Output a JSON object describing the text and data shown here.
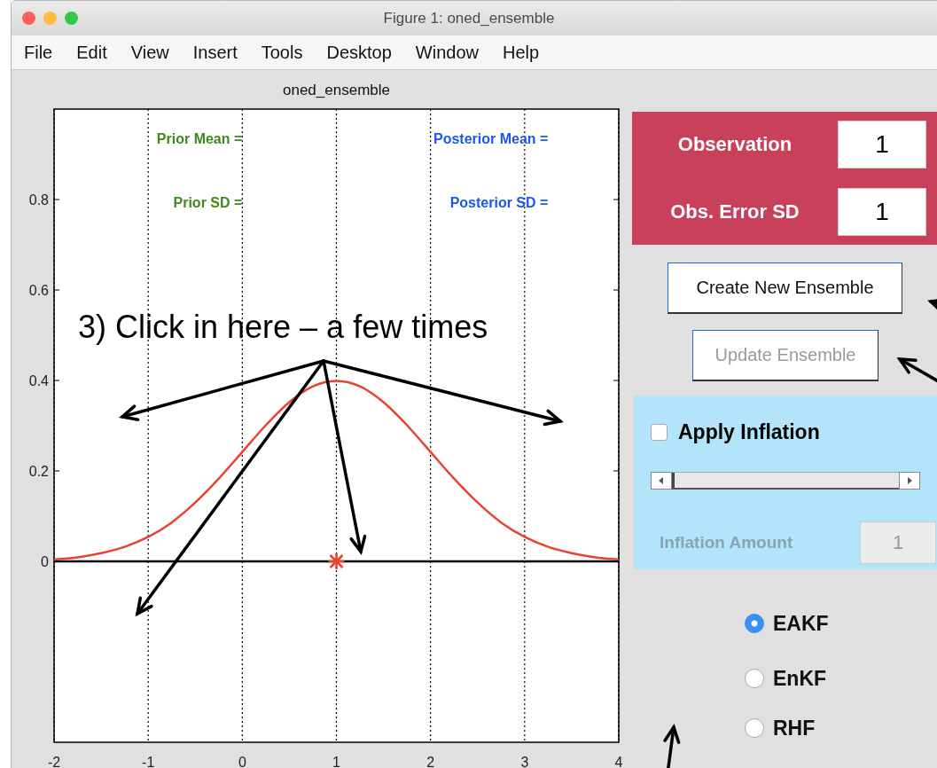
{
  "window": {
    "title": "Figure 1: oned_ensemble"
  },
  "menu": [
    "File",
    "Edit",
    "View",
    "Insert",
    "Tools",
    "Desktop",
    "Window",
    "Help"
  ],
  "plot": {
    "chart_data": {
      "type": "line",
      "title": "oned_ensemble",
      "x": [
        -2,
        -1.75,
        -1.5,
        -1.25,
        -1,
        -0.75,
        -0.5,
        -0.25,
        0,
        0.25,
        0.5,
        0.75,
        1,
        1.25,
        1.5,
        1.75,
        2,
        2.25,
        2.5,
        2.75,
        3,
        3.25,
        3.5,
        3.75,
        4
      ],
      "series": [
        {
          "color": "#e8432e",
          "values": [
            0.004,
            0.009,
            0.018,
            0.032,
            0.054,
            0.086,
            0.13,
            0.183,
            0.242,
            0.301,
            0.352,
            0.387,
            0.399,
            0.387,
            0.352,
            0.301,
            0.242,
            0.183,
            0.13,
            0.086,
            0.054,
            0.032,
            0.018,
            0.009,
            0.004
          ]
        }
      ],
      "xlim": [
        -2,
        4
      ],
      "ylim": [
        -0.4,
        1
      ],
      "xticks": [
        -2,
        -1,
        0,
        1,
        2,
        3,
        4
      ],
      "yticks": [
        0,
        0.2,
        0.4,
        0.6,
        0.8
      ],
      "grid": true
    },
    "labels": [
      {
        "text": "Prior Mean =",
        "color": "#3c8a1c"
      },
      {
        "text": "Posterior Mean =",
        "color": "#1a56f0"
      },
      {
        "text": "Prior SD =",
        "color": "#3c8a1c"
      },
      {
        "text": "Posterior SD =",
        "color": "#1a56f0"
      }
    ]
  },
  "observation_panel": {
    "fields": [
      {
        "label": "Observation",
        "value": "1"
      },
      {
        "label": "Obs. Error SD",
        "value": "1"
      }
    ]
  },
  "buttons": [
    {
      "label": "Create New Ensemble",
      "disabled": false
    },
    {
      "label": "Update Ensemble",
      "disabled": true
    }
  ],
  "inflation": {
    "checkbox": {
      "label": "Apply Inflation",
      "checked": false
    },
    "slider": {
      "level": 0
    },
    "amount": {
      "label": "Inflation Amount",
      "value": "1",
      "disabled": true
    }
  },
  "filter_options": [
    {
      "label": "EAKF",
      "selected": true
    },
    {
      "label": "EnKF",
      "selected": false
    },
    {
      "label": "RHF",
      "selected": false
    }
  ],
  "callout": {
    "text": "3) Click in here – a few times"
  }
}
